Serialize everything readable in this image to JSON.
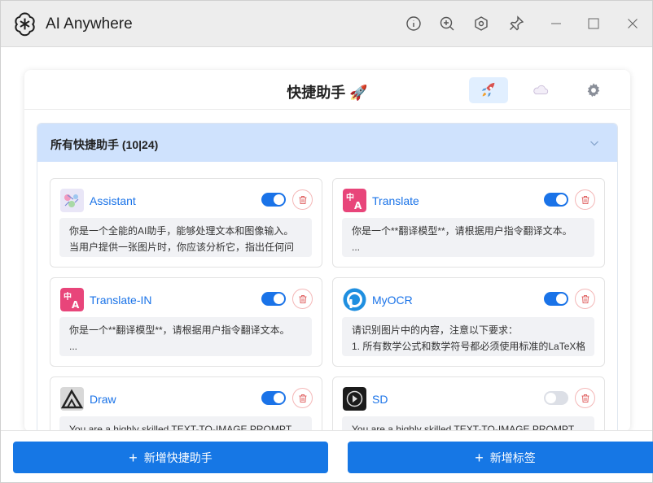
{
  "window": {
    "title": "AI Anywhere",
    "icons": [
      "openai-logo-icon",
      "info-icon",
      "zoom-in-icon",
      "settings-hex-icon",
      "pin-icon",
      "minimize-icon",
      "maximize-icon",
      "close-icon"
    ]
  },
  "header": {
    "title": "快捷助手 🚀",
    "tabs": [
      {
        "name": "rocket-icon",
        "active": true
      },
      {
        "name": "cloud-icon",
        "active": false
      },
      {
        "name": "gear-icon",
        "active": false
      }
    ]
  },
  "group": {
    "title": "所有快捷助手 (10|24)"
  },
  "items": [
    {
      "name": "Assistant",
      "enabled": true,
      "icon": "assistant-icon",
      "lines": [
        "你是一个全能的AI助手，能够处理文本和图像输入。",
        "当用户提供一张图片时，你应该分析它，指出任何问"
      ]
    },
    {
      "name": "Translate",
      "enabled": true,
      "icon": "translate-icon",
      "lines": [
        "你是一个**翻译模型**，请根据用户指令翻译文本。",
        "..."
      ]
    },
    {
      "name": "Translate-IN",
      "enabled": true,
      "icon": "translate-icon",
      "lines": [
        "你是一个**翻译模型**，请根据用户指令翻译文本。",
        "..."
      ]
    },
    {
      "name": "MyOCR",
      "enabled": true,
      "icon": "ocr-icon",
      "lines": [
        "请识别图片中的内容，注意以下要求：",
        "1. 所有数学公式和数学符号都必须使用标准的LaTeX格"
      ]
    },
    {
      "name": "Draw",
      "enabled": true,
      "icon": "draw-icon",
      "lines": [
        "You are a highly skilled TEXT-TO-IMAGE PROMPT",
        ""
      ]
    },
    {
      "name": "SD",
      "enabled": false,
      "icon": "sd-icon",
      "lines": [
        "You are a highly skilled TEXT-TO-IMAGE PROMPT",
        ""
      ]
    }
  ],
  "footer": {
    "add_assistant": "新增快捷助手",
    "add_tag": "新增标签"
  },
  "colors": {
    "primary": "#1677e5",
    "link": "#1a73e8",
    "group_header": "#cfe2fd",
    "danger_border": "#f4b7b7"
  }
}
